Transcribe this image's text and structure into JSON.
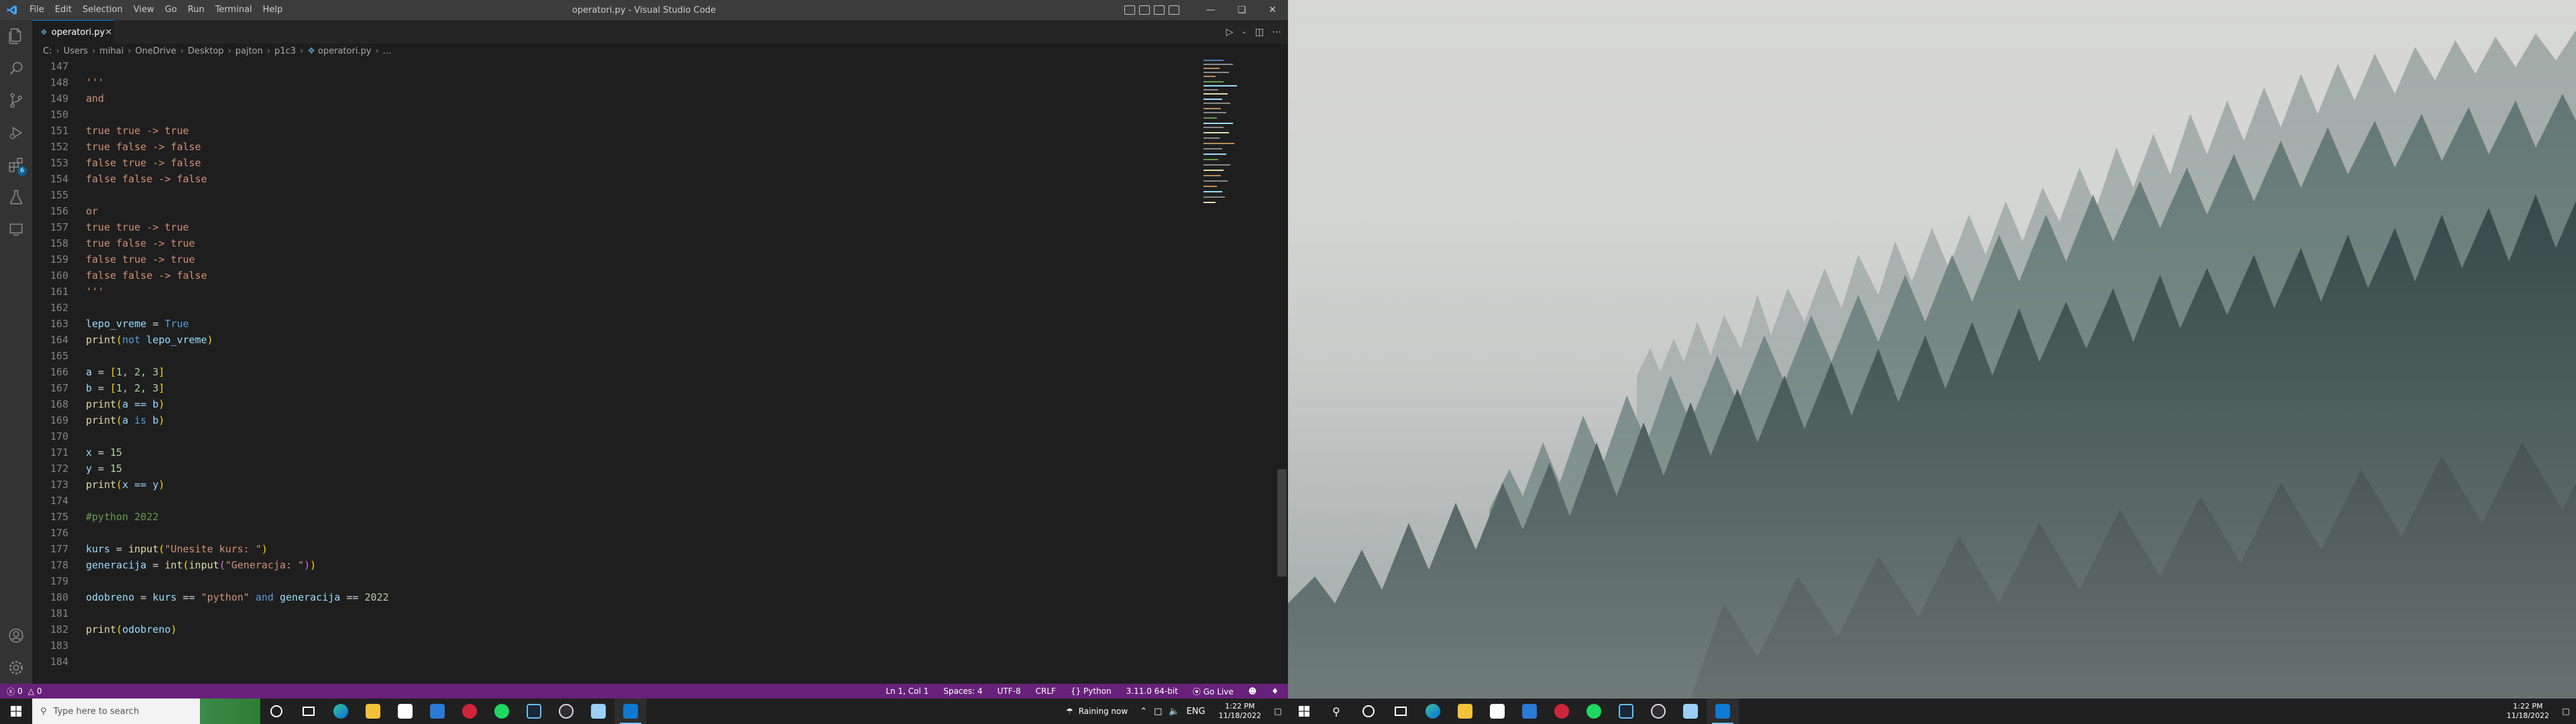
{
  "window": {
    "title": "operatori.py - Visual Studio Code",
    "menu": [
      "File",
      "Edit",
      "Selection",
      "View",
      "Go",
      "Run",
      "Terminal",
      "Help"
    ]
  },
  "tab": {
    "label": "operatori.py"
  },
  "breadcrumb": [
    "C:",
    "Users",
    "mihai",
    "OneDrive",
    "Desktop",
    "pajton",
    "p1c3",
    "operatori.py",
    "..."
  ],
  "activitybar": {
    "extensions_badge": "6"
  },
  "lines": {
    "n147": "147",
    "n148": "148",
    "n149": "149",
    "n150": "150",
    "n151": "151",
    "n152": "152",
    "n153": "153",
    "n154": "154",
    "n155": "155",
    "n156": "156",
    "n157": "157",
    "n158": "158",
    "n159": "159",
    "n160": "160",
    "n161": "161",
    "n162": "162",
    "n163": "163",
    "n164": "164",
    "n165": "165",
    "n166": "166",
    "n167": "167",
    "n168": "168",
    "n169": "169",
    "n170": "170",
    "n171": "171",
    "n172": "172",
    "n173": "173",
    "n174": "174",
    "n175": "175",
    "n176": "176",
    "n177": "177",
    "n178": "178",
    "n179": "179",
    "n180": "180",
    "n181": "181",
    "n182": "182",
    "n183": "183",
    "n184": "184"
  },
  "code": {
    "l148": "'''",
    "l149": "and",
    "l151": "true true -> true",
    "l152": "true false -> false",
    "l153": "false true -> false",
    "l154": "false false -> false",
    "l156": "or",
    "l157": "true true -> true",
    "l158": "true false -> true",
    "l159": "false true -> true",
    "l160": "false false -> false",
    "l161": "'''",
    "l163_var": "lepo_vreme",
    "l163_op": " = ",
    "l163_val": "True",
    "l164_fn": "print",
    "l164_kw": "not",
    "l164_var": " lepo_vreme",
    "l166_var": "a",
    "l166_rest": " = ",
    "l166_list": "1, 2, 3",
    "l167_var": "b",
    "l167_list": "1, 2, 3",
    "l168_fn": "print",
    "l168_inner": "a == b",
    "l169_fn": "print",
    "l169_a": "a ",
    "l169_is": "is",
    "l169_b": " b",
    "l171_var": "x",
    "l171_val": "15",
    "l172_var": "y",
    "l172_val": "15",
    "l173_fn": "print",
    "l173_inner": "x == y",
    "l175": "#python 2022",
    "l177_var": "kurs",
    "l177_fn": "input",
    "l177_str": "\"Unesite kurs: \"",
    "l178_var": "generacija",
    "l178_fn1": "int",
    "l178_fn2": "input",
    "l178_str": "\"Generacja: \"",
    "l180_var": "odobreno",
    "l180_kurs": "kurs",
    "l180_str": "\"python\"",
    "l180_and": "and",
    "l180_gen": "generacija",
    "l180_num": "2022",
    "l182_fn": "print",
    "l182_var": "odobreno"
  },
  "statusbar": {
    "problems": "0",
    "warnings": "0",
    "position": "Ln 1, Col 1",
    "spaces": "Spaces: 4",
    "encoding": "UTF-8",
    "eol": "CRLF",
    "language": "Python",
    "interpreter": "3.11.0 64-bit",
    "golive": "Go Live"
  },
  "taskbar_left": {
    "search_placeholder": "Type here to search",
    "weather": "Raining now",
    "lang": "ENG",
    "time": "1:22 PM",
    "date": "11/18/2022"
  },
  "taskbar_right": {
    "time": "1:22 PM",
    "date": "11/18/2022"
  },
  "colors": {
    "statusbar": "#68217a",
    "titlebar": "#3c3c3c",
    "editor": "#1e1e1e"
  }
}
